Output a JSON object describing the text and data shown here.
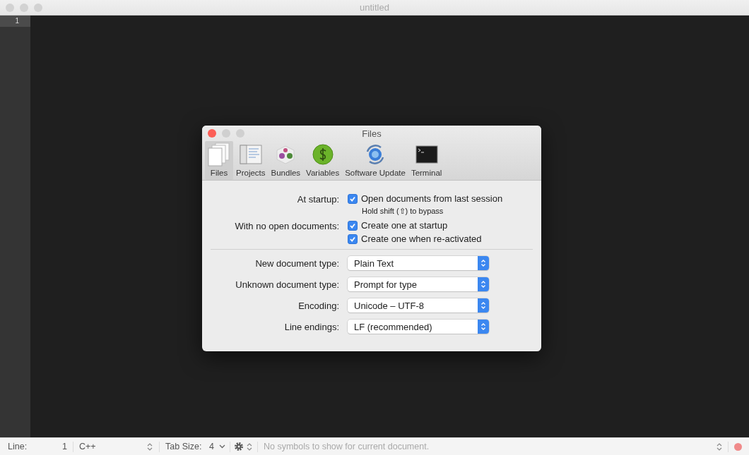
{
  "window": {
    "title": "untitled"
  },
  "gutter": {
    "line_numbers": [
      {
        "text": "1",
        "selected": true
      }
    ]
  },
  "dialog": {
    "title": "Files",
    "tabs": [
      {
        "label": "Files",
        "kind": "documents",
        "selected": true
      },
      {
        "label": "Projects",
        "kind": "projects",
        "selected": false
      },
      {
        "label": "Bundles",
        "kind": "bundles",
        "selected": false
      },
      {
        "label": "Variables",
        "kind": "variables",
        "selected": false
      },
      {
        "label": "Software Update",
        "kind": "update",
        "selected": false
      },
      {
        "label": "Terminal",
        "kind": "terminal",
        "selected": false
      }
    ],
    "settings": [
      {
        "kind": "checkbox",
        "label": "At startup:",
        "options": [
          {
            "text": "Open documents from last session",
            "checked": true,
            "note": "Hold shift (⇧) to bypass"
          }
        ]
      },
      {
        "kind": "checkbox",
        "label": "With no open documents:",
        "options": [
          {
            "text": "Create one at startup",
            "checked": true
          },
          {
            "text": "Create one when re-activated",
            "checked": true
          }
        ]
      },
      {
        "kind": "divider"
      },
      {
        "kind": "popup",
        "label": "New document type:",
        "value": "Plain Text"
      },
      {
        "kind": "popup",
        "label": "Unknown document type:",
        "value": "Prompt for type"
      },
      {
        "kind": "popup",
        "label": "Encoding:",
        "value": "Unicode – UTF-8"
      },
      {
        "kind": "popup",
        "label": "Line endings:",
        "value": "LF (recommended)"
      }
    ]
  },
  "status_bar": {
    "line_label": "Line:",
    "line_value": "1",
    "language": "C++",
    "tab_size_label": "Tab Size:",
    "tab_size": "4",
    "symbols": "No symbols to show for current document."
  }
}
